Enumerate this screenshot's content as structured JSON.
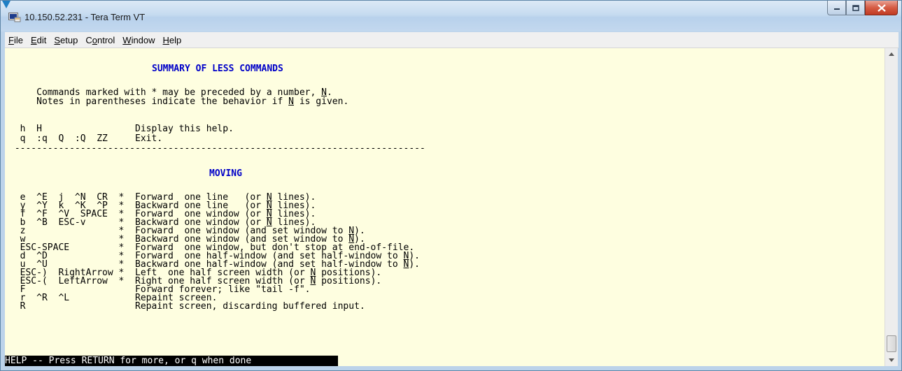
{
  "window": {
    "title": "10.150.52.231 - Tera Term VT",
    "accent": "#b8d1ec",
    "close_color": "#c8452d"
  },
  "menubar": {
    "items": [
      {
        "pre": "",
        "mnemonic": "F",
        "post": "ile"
      },
      {
        "pre": "",
        "mnemonic": "E",
        "post": "dit"
      },
      {
        "pre": "",
        "mnemonic": "S",
        "post": "etup"
      },
      {
        "pre": "C",
        "mnemonic": "o",
        "post": "ntrol"
      },
      {
        "pre": "",
        "mnemonic": "W",
        "post": "indow"
      },
      {
        "pre": "",
        "mnemonic": "H",
        "post": "elp"
      }
    ]
  },
  "terminal": {
    "background": "#fefee0",
    "heading_color": "#0000c8",
    "lines": {
      "summary_title": "SUMMARY OF LESS COMMANDS",
      "intro1_a": "     Commands marked with * may be preceded by a number, ",
      "intro1_n": "N",
      "intro1_b": ".",
      "intro2_a": "     Notes in parentheses indicate the behavior if ",
      "intro2_n": "N",
      "intro2_b": " is given.",
      "help_line": "  h  H                 Display this help.",
      "quit_line": "  q  :q  Q  :Q  ZZ     Exit.",
      "divider": " ---------------------------------------------------------------------------",
      "moving_title": "MOVING",
      "m1_a": "  e  ^E  j  ^N  CR  *  Forward  one line   (or ",
      "m1_b": " lines).",
      "m2_a": "  y  ^Y  k  ^K  ^P  *  Backward one line   (or ",
      "m2_b": " lines).",
      "m3_a": "  f  ^F  ^V  SPACE  *  Forward  one window (or ",
      "m3_b": " lines).",
      "m4_a": "  b  ^B  ESC-v      *  Backward one window (or ",
      "m4_b": " lines).",
      "m5_a": "  z                 *  Forward  one window (and set window to ",
      "m5_b": ").",
      "m6_a": "  w                 *  Backward one window (and set window to ",
      "m6_b": ").",
      "m7": "  ESC-SPACE         *  Forward  one window, but don't stop at end-of-file.",
      "m8_a": "  d  ^D             *  Forward  one half-window (and set half-window to ",
      "m8_b": ").",
      "m9_a": "  u  ^U             *  Backward one half-window (and set half-window to ",
      "m9_b": ").",
      "m10_a": "  ESC-)  RightArrow *  Left  one half screen width (or ",
      "m10_b": " positions).",
      "m11_a": "  ESC-(  LeftArrow  *  Right one half screen width (or ",
      "m11_b": " positions).",
      "m12": "  F                    Forward forever; like \"tail -f\".",
      "m13": "  r  ^R  ^L            Repaint screen.",
      "m14": "  R                    Repaint screen, discarding buffered input.",
      "n": "N"
    },
    "status_bar": "HELP -- Press RETURN for more, or q when done"
  },
  "icons": {
    "app": "tera-term-icon",
    "minimize": "minimize-icon",
    "maximize": "maximize-icon",
    "close": "close-icon",
    "scroll_up": "scroll-up-arrow-icon",
    "scroll_down": "scroll-down-arrow-icon"
  }
}
